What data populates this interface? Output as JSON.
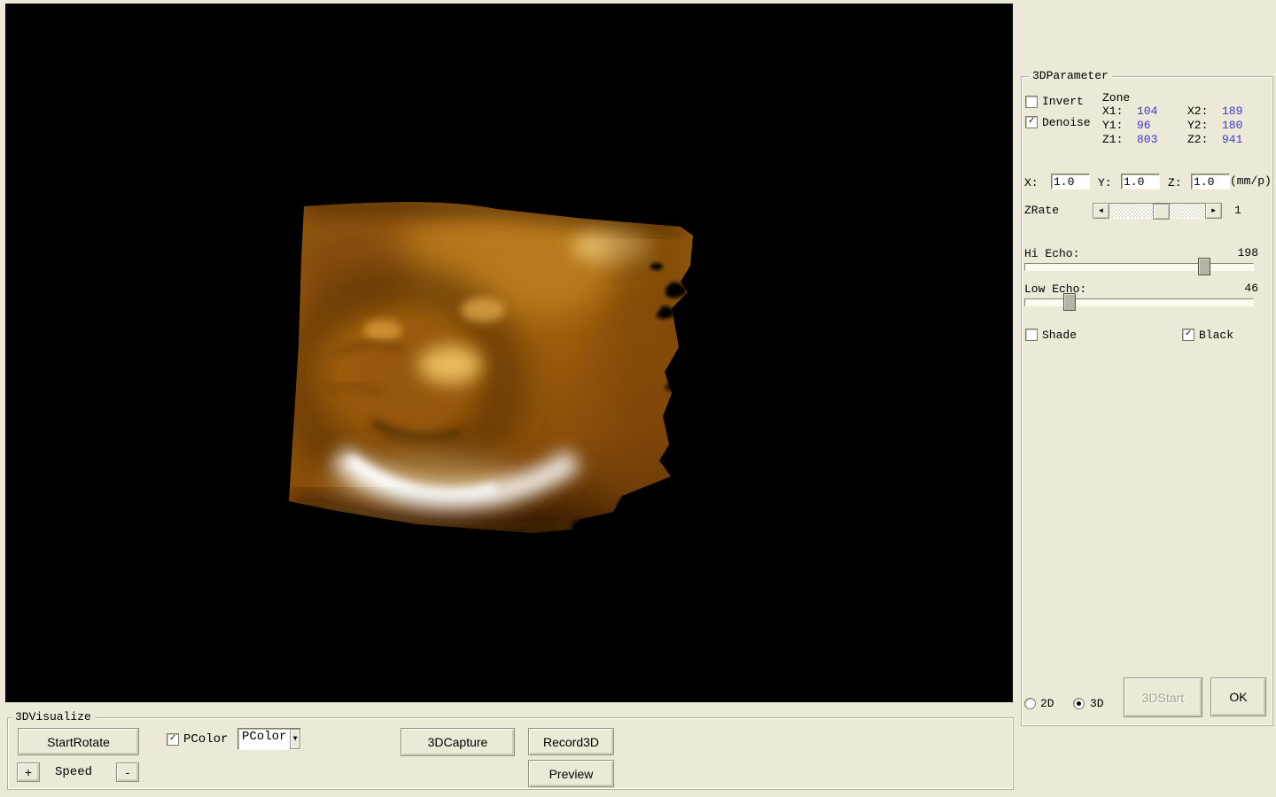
{
  "colors": {
    "panel_bg": "#ece9d8",
    "viewport_bg": "#000000",
    "zone_value_text": "#3b3bc6",
    "render_base": "#a5640f"
  },
  "icons": {
    "check": "✓",
    "dropdown_arrow": "▼",
    "scroll_left": "◄",
    "scroll_right": "►"
  },
  "param_panel": {
    "title": "3DParameter",
    "invert_label": "Invert",
    "invert_checked": false,
    "denoise_label": "Denoise",
    "denoise_checked": true,
    "zone": {
      "title": "Zone",
      "x1_label": "X1:",
      "x1_value": "104",
      "x2_label": "X2:",
      "x2_value": "189",
      "y1_label": "Y1:",
      "y1_value": "96",
      "y2_label": "Y2:",
      "y2_value": "180",
      "z1_label": "Z1:",
      "z1_value": "803",
      "z2_label": "Z2:",
      "z2_value": "941"
    },
    "scale": {
      "x_label": "X:",
      "x_value": "1.0",
      "y_label": "Y:",
      "y_value": "1.0",
      "z_label": "Z:",
      "z_value": "1.0",
      "unit": "(mm/p)"
    },
    "zrate": {
      "label": "ZRate",
      "value": "1"
    },
    "hi_echo": {
      "label": "Hi Echo:",
      "value": "198"
    },
    "low_echo": {
      "label": "Low Echo:",
      "value": "46"
    },
    "shade_label": "Shade",
    "shade_checked": false,
    "black_label": "Black",
    "black_checked": true,
    "mode_2d_label": "2D",
    "mode_3d_label": "3D",
    "selected_mode": "3D",
    "start3d_label": "3DStart",
    "start3d_enabled": false,
    "ok_label": "OK"
  },
  "visualize_panel": {
    "title": "3DVisualize",
    "start_rotate_label": "StartRotate",
    "pcolor_label": "PColor",
    "pcolor_checked": true,
    "pcolor_selected": "PColor",
    "capture_label": "3DCapture",
    "record_label": "Record3D",
    "preview_label": "Preview",
    "speed_plus_label": "+",
    "speed_label": "Speed",
    "speed_minus_label": "-"
  }
}
